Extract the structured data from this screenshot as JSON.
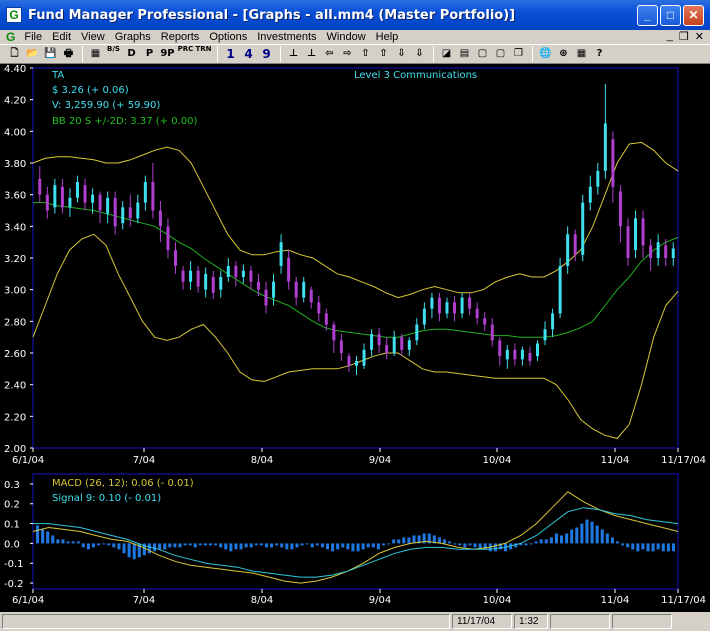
{
  "window": {
    "title": "Fund Manager Professional - [Graphs - all.mm4 (Master Portfolio)]",
    "app_icon": "G",
    "minimize_glyph": "_",
    "maximize_glyph": "□",
    "close_glyph": "✕"
  },
  "menu": {
    "icon": "G",
    "items": [
      "File",
      "Edit",
      "View",
      "Graphs",
      "Reports",
      "Options",
      "Investments",
      "Window",
      "Help"
    ],
    "mdi_min": "_",
    "mdi_restore": "❐",
    "mdi_close": "✕"
  },
  "toolbar": {
    "buttons": [
      {
        "name": "new-icon",
        "glyph": "🗋"
      },
      {
        "name": "open-icon",
        "glyph": "📂"
      },
      {
        "name": "save-icon",
        "glyph": "💾"
      },
      {
        "name": "print-icon",
        "glyph": "🖶"
      },
      {
        "name": "sep"
      },
      {
        "name": "calculator-icon",
        "glyph": "▦"
      },
      {
        "name": "buy-sell-icon",
        "glyph": "B/S",
        "small": true
      },
      {
        "name": "daily-icon",
        "glyph": "D"
      },
      {
        "name": "price-icon",
        "glyph": "P"
      },
      {
        "name": "nine-p-icon",
        "glyph": "9P"
      },
      {
        "name": "prc-icon",
        "glyph": "PRC",
        "small": true
      },
      {
        "name": "trn-icon",
        "glyph": "TRN",
        "small": true
      },
      {
        "name": "sep"
      },
      {
        "name": "one-button",
        "glyph": "1",
        "num": true
      },
      {
        "name": "four-button",
        "glyph": "4",
        "num": true
      },
      {
        "name": "nine-button",
        "glyph": "9",
        "num": true
      },
      {
        "name": "sep"
      },
      {
        "name": "scale-icon",
        "glyph": "⊥"
      },
      {
        "name": "axis-icon",
        "glyph": "⊥"
      },
      {
        "name": "arrow-left-icon",
        "glyph": "⇦"
      },
      {
        "name": "arrow-right-icon",
        "glyph": "⇨"
      },
      {
        "name": "arrow-up-icon",
        "glyph": "⇧"
      },
      {
        "name": "arrow-up2-icon",
        "glyph": "⇧"
      },
      {
        "name": "arrow-down-icon",
        "glyph": "⇩"
      },
      {
        "name": "arrow-down2-icon",
        "glyph": "⇩"
      },
      {
        "name": "sep"
      },
      {
        "name": "graph-icon",
        "glyph": "◪"
      },
      {
        "name": "grid-icon",
        "glyph": "▤"
      },
      {
        "name": "window-icon",
        "glyph": "▢"
      },
      {
        "name": "window2-icon",
        "glyph": "▢"
      },
      {
        "name": "windows-icon",
        "glyph": "❐"
      },
      {
        "name": "sep"
      },
      {
        "name": "globe-icon",
        "glyph": "🌐"
      },
      {
        "name": "globe-update-icon",
        "glyph": "⊛"
      },
      {
        "name": "calc-icon",
        "glyph": "▦"
      },
      {
        "name": "help-icon",
        "glyph": "?"
      }
    ]
  },
  "colors": {
    "frame": "#1515c8",
    "up": "#40e0f0",
    "down": "#b040d0",
    "bollinger": "#d8c838",
    "sma": "#20b020",
    "macd": "#d8c838",
    "signal": "#30c8d8",
    "histogram": "#1e78e0",
    "axis_text": "#ffffff"
  },
  "legend": {
    "ta": "TA",
    "price": "$ 3.26 (+ 0.06)",
    "volume": "V: 3,259.90 (+ 59.90)",
    "bb": "BB 20 S +/-2D: 3.37 (+ 0.00)",
    "symbol_title": "Level 3 Communications",
    "macd": "MACD (26, 12): 0.06 (- 0.01)",
    "signal": "Signal 9: 0.10 (- 0.01)"
  },
  "status": {
    "date": "11/17/04",
    "time": "1:32"
  },
  "chart_data": [
    {
      "type": "candlestick",
      "title": "Level 3 Communications",
      "ylim": [
        2.0,
        4.4
      ],
      "yticks": [
        "2.00",
        "2.20",
        "2.40",
        "2.60",
        "2.80",
        "3.00",
        "3.20",
        "3.40",
        "3.60",
        "3.80",
        "4.00",
        "4.20",
        "4.40"
      ],
      "xticks": [
        "6/1/04",
        "7/04",
        "8/04",
        "9/04",
        "10/04",
        "11/04",
        "11/17/04"
      ],
      "grid": false,
      "candles": [
        [
          3.7,
          3.6,
          3.78,
          3.55
        ],
        [
          3.6,
          3.5,
          3.65,
          3.45
        ],
        [
          3.52,
          3.66,
          3.7,
          3.48
        ],
        [
          3.65,
          3.52,
          3.7,
          3.48
        ],
        [
          3.52,
          3.58,
          3.64,
          3.46
        ],
        [
          3.58,
          3.68,
          3.72,
          3.55
        ],
        [
          3.66,
          3.55,
          3.7,
          3.5
        ],
        [
          3.55,
          3.6,
          3.64,
          3.48
        ],
        [
          3.6,
          3.5,
          3.62,
          3.42
        ],
        [
          3.48,
          3.58,
          3.62,
          3.42
        ],
        [
          3.58,
          3.4,
          3.62,
          3.35
        ],
        [
          3.42,
          3.52,
          3.56,
          3.38
        ],
        [
          3.52,
          3.45,
          3.6,
          3.4
        ],
        [
          3.45,
          3.55,
          3.6,
          3.42
        ],
        [
          3.55,
          3.68,
          3.72,
          3.5
        ],
        [
          3.68,
          3.5,
          3.8,
          3.45
        ],
        [
          3.5,
          3.4,
          3.56,
          3.3
        ],
        [
          3.4,
          3.25,
          3.45,
          3.2
        ],
        [
          3.25,
          3.15,
          3.3,
          3.1
        ],
        [
          3.12,
          3.05,
          3.15,
          3.0
        ],
        [
          3.05,
          3.12,
          3.18,
          3.0
        ],
        [
          3.12,
          3.02,
          3.15,
          2.98
        ],
        [
          3.0,
          3.1,
          3.14,
          2.95
        ],
        [
          3.08,
          2.98,
          3.12,
          2.94
        ],
        [
          3.0,
          3.08,
          3.12,
          2.95
        ],
        [
          3.08,
          3.15,
          3.2,
          3.05
        ],
        [
          3.15,
          3.08,
          3.18,
          3.02
        ],
        [
          3.08,
          3.12,
          3.16,
          3.04
        ],
        [
          3.12,
          3.05,
          3.15,
          3.0
        ],
        [
          3.05,
          3.0,
          3.1,
          2.96
        ],
        [
          3.0,
          2.9,
          3.05,
          2.85
        ],
        [
          2.95,
          3.05,
          3.1,
          2.9
        ],
        [
          3.15,
          3.3,
          3.35,
          3.1
        ],
        [
          3.2,
          3.05,
          3.25,
          3.0
        ],
        [
          3.05,
          2.95,
          3.08,
          2.9
        ],
        [
          2.95,
          3.05,
          3.08,
          2.92
        ],
        [
          3.0,
          2.92,
          3.02,
          2.88
        ],
        [
          2.92,
          2.85,
          2.96,
          2.8
        ],
        [
          2.85,
          2.78,
          2.88,
          2.74
        ],
        [
          2.78,
          2.68,
          2.8,
          2.6
        ],
        [
          2.68,
          2.6,
          2.72,
          2.55
        ],
        [
          2.58,
          2.52,
          2.6,
          2.48
        ],
        [
          2.52,
          2.55,
          2.58,
          2.46
        ],
        [
          2.52,
          2.62,
          2.66,
          2.5
        ],
        [
          2.62,
          2.72,
          2.75,
          2.58
        ],
        [
          2.72,
          2.65,
          2.76,
          2.6
        ],
        [
          2.65,
          2.6,
          2.7,
          2.56
        ],
        [
          2.6,
          2.7,
          2.74,
          2.58
        ],
        [
          2.7,
          2.62,
          2.72,
          2.58
        ],
        [
          2.62,
          2.68,
          2.7,
          2.58
        ],
        [
          2.68,
          2.78,
          2.82,
          2.65
        ],
        [
          2.78,
          2.88,
          2.92,
          2.75
        ],
        [
          2.88,
          2.95,
          2.98,
          2.82
        ],
        [
          2.95,
          2.85,
          2.98,
          2.8
        ],
        [
          2.85,
          2.92,
          2.95,
          2.82
        ],
        [
          2.92,
          2.85,
          2.96,
          2.8
        ],
        [
          2.85,
          2.95,
          2.98,
          2.82
        ],
        [
          2.95,
          2.88,
          2.98,
          2.84
        ],
        [
          2.88,
          2.82,
          2.92,
          2.78
        ],
        [
          2.82,
          2.78,
          2.86,
          2.74
        ],
        [
          2.78,
          2.68,
          2.82,
          2.64
        ],
        [
          2.68,
          2.58,
          2.7,
          2.52
        ],
        [
          2.56,
          2.62,
          2.65,
          2.5
        ],
        [
          2.62,
          2.56,
          2.66,
          2.52
        ],
        [
          2.56,
          2.62,
          2.64,
          2.52
        ],
        [
          2.6,
          2.55,
          2.64,
          2.52
        ],
        [
          2.58,
          2.66,
          2.68,
          2.55
        ],
        [
          2.68,
          2.75,
          2.8,
          2.65
        ],
        [
          2.75,
          2.85,
          2.88,
          2.7
        ],
        [
          2.85,
          3.15,
          3.2,
          2.82
        ],
        [
          3.15,
          3.35,
          3.4,
          3.1
        ],
        [
          3.35,
          3.22,
          3.38,
          3.18
        ],
        [
          3.22,
          3.55,
          3.6,
          3.18
        ],
        [
          3.55,
          3.65,
          3.72,
          3.5
        ],
        [
          3.65,
          3.75,
          3.8,
          3.6
        ],
        [
          3.75,
          4.05,
          4.3,
          3.7
        ],
        [
          3.95,
          3.65,
          4.0,
          3.55
        ],
        [
          3.62,
          3.4,
          3.66,
          3.3
        ],
        [
          3.4,
          3.2,
          3.45,
          3.15
        ],
        [
          3.25,
          3.45,
          3.5,
          3.2
        ],
        [
          3.45,
          3.28,
          3.5,
          3.2
        ],
        [
          3.28,
          3.2,
          3.32,
          3.12
        ],
        [
          3.2,
          3.3,
          3.35,
          3.15
        ],
        [
          3.28,
          3.2,
          3.32,
          3.15
        ],
        [
          3.2,
          3.26,
          3.3,
          3.15
        ]
      ],
      "bb_upper": [
        3.8,
        3.83,
        3.84,
        3.84,
        3.83,
        3.82,
        3.8,
        3.8,
        3.82,
        3.85,
        3.88,
        3.9,
        3.88,
        3.8,
        3.65,
        3.5,
        3.35,
        3.25,
        3.22,
        3.22,
        3.24,
        3.25,
        3.22,
        3.2,
        3.15,
        3.1,
        3.08,
        3.05,
        3.02,
        2.98,
        2.95,
        2.97,
        3.0,
        3.02,
        3.0,
        2.98,
        2.98,
        3.0,
        3.05,
        3.08,
        3.1,
        3.08,
        3.08,
        3.12,
        3.18,
        3.25,
        3.4,
        3.6,
        3.8,
        3.92,
        3.93,
        3.88,
        3.8,
        3.75
      ],
      "bb_middle": [
        3.55,
        3.55,
        3.53,
        3.52,
        3.51,
        3.5,
        3.48,
        3.46,
        3.44,
        3.42,
        3.4,
        3.35,
        3.3,
        3.26,
        3.2,
        3.15,
        3.1,
        3.05,
        3.0,
        2.96,
        2.93,
        2.9,
        2.85,
        2.8,
        2.76,
        2.74,
        2.73,
        2.72,
        2.71,
        2.7,
        2.7,
        2.72,
        2.74,
        2.75,
        2.75,
        2.74,
        2.73,
        2.72,
        2.71,
        2.71,
        2.7,
        2.7,
        2.7,
        2.71,
        2.73,
        2.76,
        2.8,
        2.9,
        3.0,
        3.08,
        3.18,
        3.25,
        3.3,
        3.33
      ],
      "bb_lower": [
        2.7,
        2.9,
        3.1,
        3.25,
        3.32,
        3.35,
        3.28,
        3.1,
        2.95,
        2.8,
        2.7,
        2.68,
        2.7,
        2.75,
        2.78,
        2.7,
        2.6,
        2.48,
        2.43,
        2.42,
        2.45,
        2.48,
        2.49,
        2.5,
        2.5,
        2.5,
        2.52,
        2.55,
        2.58,
        2.6,
        2.6,
        2.55,
        2.5,
        2.48,
        2.48,
        2.47,
        2.46,
        2.45,
        2.44,
        2.44,
        2.44,
        2.44,
        2.44,
        2.4,
        2.3,
        2.18,
        2.12,
        2.08,
        2.06,
        2.15,
        2.4,
        2.7,
        2.9,
        2.99
      ]
    },
    {
      "type": "macd",
      "ylim": [
        -0.23,
        0.35
      ],
      "yticks": [
        "0.3",
        "0.2",
        "0.1",
        "0.0",
        "-0.1",
        "-0.2"
      ],
      "xticks": [
        "6/1/04",
        "7/04",
        "8/04",
        "9/04",
        "10/04",
        "11/04",
        "11/17/04"
      ],
      "macd": [
        0.06,
        0.08,
        0.07,
        0.06,
        0.04,
        0.02,
        0.01,
        -0.02,
        -0.06,
        -0.09,
        -0.11,
        -0.12,
        -0.13,
        -0.14,
        -0.15,
        -0.17,
        -0.19,
        -0.2,
        -0.19,
        -0.17,
        -0.14,
        -0.1,
        -0.05,
        -0.02,
        0.0,
        0.01,
        0.0,
        -0.02,
        -0.03,
        -0.02,
        0.0,
        0.04,
        0.1,
        0.18,
        0.26,
        0.21,
        0.17,
        0.14,
        0.12,
        0.1,
        0.08,
        0.06
      ],
      "signal": [
        0.1,
        0.1,
        0.09,
        0.08,
        0.06,
        0.04,
        0.02,
        -0.01,
        -0.03,
        -0.06,
        -0.08,
        -0.1,
        -0.11,
        -0.12,
        -0.14,
        -0.15,
        -0.16,
        -0.17,
        -0.17,
        -0.16,
        -0.14,
        -0.11,
        -0.08,
        -0.05,
        -0.03,
        -0.02,
        -0.02,
        -0.03,
        -0.03,
        -0.03,
        -0.02,
        0.0,
        0.04,
        0.1,
        0.16,
        0.18,
        0.17,
        0.15,
        0.14,
        0.12,
        0.11,
        0.1
      ],
      "histogram": [
        0.09,
        0.07,
        0.06,
        0.04,
        0.02,
        0.02,
        0.01,
        0.01,
        0.01,
        -0.02,
        -0.03,
        -0.02,
        -0.01,
        0.0,
        -0.01,
        -0.02,
        -0.03,
        -0.05,
        -0.07,
        -0.08,
        -0.07,
        -0.06,
        -0.05,
        -0.04,
        -0.03,
        -0.03,
        -0.02,
        -0.02,
        -0.02,
        -0.01,
        -0.01,
        -0.02,
        -0.01,
        -0.01,
        -0.01,
        -0.01,
        -0.02,
        -0.03,
        -0.04,
        -0.03,
        -0.03,
        -0.02,
        -0.02,
        -0.01,
        -0.01,
        -0.02,
        -0.02,
        -0.01,
        -0.02,
        -0.03,
        -0.03,
        -0.02,
        -0.01,
        0.0,
        -0.02,
        -0.01,
        -0.02,
        -0.03,
        -0.04,
        -0.03,
        -0.02,
        -0.03,
        -0.04,
        -0.04,
        -0.03,
        -0.02,
        -0.02,
        -0.03,
        -0.01,
        0.0,
        0.02,
        0.02,
        0.03,
        0.03,
        0.04,
        0.04,
        0.05,
        0.05,
        0.04,
        0.03,
        0.02,
        0.01,
        0.0,
        -0.01,
        -0.02,
        -0.01,
        -0.02,
        -0.03,
        -0.03,
        -0.04,
        -0.04,
        -0.03,
        -0.04,
        -0.03,
        -0.02,
        -0.01,
        -0.01,
        0.0,
        0.01,
        0.02,
        0.02,
        0.03,
        0.05,
        0.04,
        0.05,
        0.07,
        0.08,
        0.1,
        0.12,
        0.11,
        0.09,
        0.07,
        0.05,
        0.03,
        0.01,
        -0.01,
        -0.02,
        -0.03,
        -0.04,
        -0.03,
        -0.04,
        -0.04,
        -0.03,
        -0.04,
        -0.04,
        -0.04
      ]
    }
  ]
}
